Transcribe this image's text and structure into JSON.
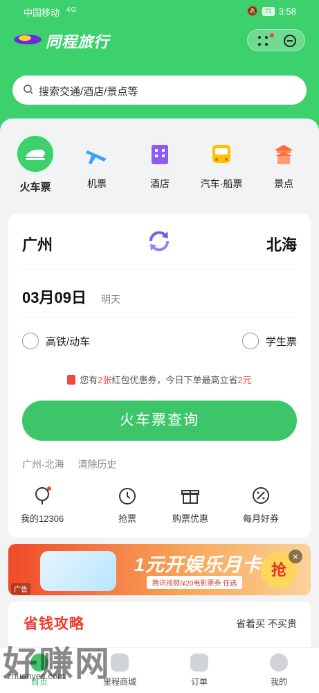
{
  "status_bar": {
    "carrier": "中国移动",
    "signal": "4G",
    "time": "3:58",
    "battery": "71"
  },
  "header": {
    "app_name": "同程旅行"
  },
  "search": {
    "placeholder": "搜索交通/酒店/景点等"
  },
  "categories": [
    {
      "label": "火车票",
      "icon": "train-icon"
    },
    {
      "label": "机票",
      "icon": "plane-icon"
    },
    {
      "label": "酒店",
      "icon": "hotel-icon"
    },
    {
      "label": "汽车·船票",
      "icon": "bus-icon"
    },
    {
      "label": "景点",
      "icon": "attraction-icon"
    }
  ],
  "booking": {
    "from_city": "广州",
    "to_city": "北海",
    "date": "03月09日",
    "weekday": "明天",
    "option_highspeed": "高铁/动车",
    "option_student": "学生票",
    "coupon_prefix": "您有",
    "coupon_count": "2张",
    "coupon_middle": "红包优惠券，今日下单最高立省",
    "coupon_amount": "2元",
    "query_button": "火车票查询",
    "history_route": "广州-北海",
    "clear_history": "清除历史"
  },
  "quick_links": [
    {
      "label": "我的12306",
      "icon": "my12306-icon"
    },
    {
      "label": "抢票",
      "icon": "clock-icon"
    },
    {
      "label": "购票优惠",
      "icon": "gift-icon"
    },
    {
      "label": "每月好券",
      "icon": "coupon-icon"
    }
  ],
  "banner": {
    "headline": "1元开娱乐月卡",
    "subline": "腾讯视频/¥20电影票券 任选",
    "grab": "抢",
    "ad_label": "广告"
  },
  "saving_section": {
    "title": "省钱攻略",
    "slogan": "省着买 不买贵"
  },
  "tabbar": [
    {
      "label": "首页",
      "active": true
    },
    {
      "label": "里程商城",
      "active": false
    },
    {
      "label": "订单",
      "active": false
    },
    {
      "label": "我的",
      "active": false
    }
  ],
  "watermark": {
    "text": "好赚网",
    "url": "zhuanyes.com"
  },
  "colors": {
    "brand_green": "#3cd16c",
    "accent_red": "#f04a3e"
  }
}
